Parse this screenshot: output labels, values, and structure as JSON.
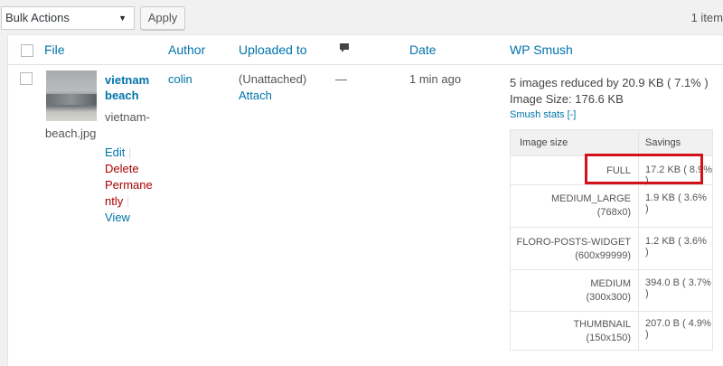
{
  "bulk": {
    "selected": "Bulk Actions",
    "apply_label": "Apply",
    "item_count": "1 item"
  },
  "columns": {
    "file": "File",
    "author": "Author",
    "uploaded_to": "Uploaded to",
    "comments_icon": "comment-bubble-icon",
    "date": "Date",
    "smush": "WP Smush"
  },
  "row": {
    "title_line1": "vietnam",
    "title_line2": "beach",
    "filename_line1": "vietnam-",
    "filename_line2": "beach.jpg",
    "actions": {
      "edit": "Edit",
      "delete_line1": "Delete",
      "delete_line2": "Permane",
      "delete_line3": "ntly",
      "view": "View",
      "separator": "|"
    },
    "author": "colin",
    "uploaded_to": "(Unattached)",
    "attach": "Attach",
    "comments": "—",
    "date": "1 min ago",
    "smush": {
      "summary": "5 images reduced by 20.9 KB ( 7.1% )",
      "image_size": "Image Size: 176.6 KB",
      "stats_link": "Smush stats [-]",
      "table_headers": {
        "size": "Image size",
        "savings": "Savings"
      },
      "rows": [
        {
          "name": "FULL",
          "dims": "",
          "saving": "17.2 KB ( 8.9% )"
        },
        {
          "name": "MEDIUM_LARGE",
          "dims": "(768x0)",
          "saving": "1.9 KB ( 3.6% )"
        },
        {
          "name": "FLORO-POSTS-WIDGET",
          "dims": "(600x99999)",
          "saving": "1.2 KB ( 3.6% )"
        },
        {
          "name": "MEDIUM",
          "dims": "(300x300)",
          "saving": "394.0 B ( 3.7% )"
        },
        {
          "name": "THUMBNAIL",
          "dims": "(150x150)",
          "saving": "207.0 B ( 4.9% )"
        }
      ]
    }
  },
  "colors": {
    "link": "#0073aa",
    "delete": "#aa0000",
    "highlight": "#d2111a"
  }
}
